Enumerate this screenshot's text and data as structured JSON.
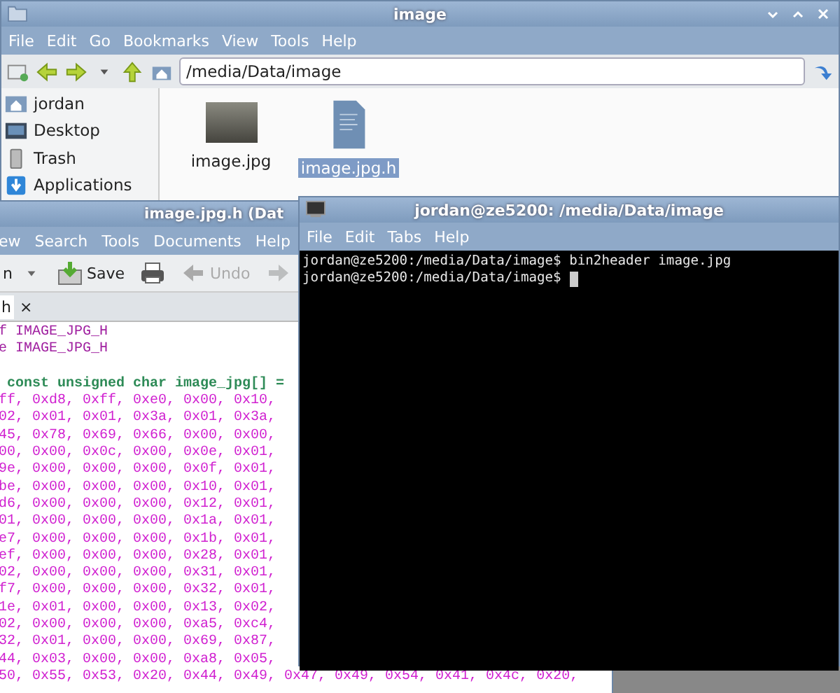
{
  "file_manager": {
    "title": "image",
    "menu": [
      "File",
      "Edit",
      "Go",
      "Bookmarks",
      "View",
      "Tools",
      "Help"
    ],
    "location": "/media/Data/image",
    "sidebar": [
      {
        "label": "jordan",
        "kind": "home"
      },
      {
        "label": "Desktop",
        "kind": "desktop"
      },
      {
        "label": "Trash",
        "kind": "trash"
      },
      {
        "label": "Applications",
        "kind": "apps"
      }
    ],
    "files": [
      {
        "name": "image.jpg",
        "kind": "photo",
        "selected": false
      },
      {
        "name": "image.jpg.h",
        "kind": "text",
        "selected": true
      }
    ]
  },
  "editor": {
    "title": "image.jpg.h (Dat",
    "menu": [
      "ew",
      "Search",
      "Tools",
      "Documents",
      "Help"
    ],
    "toolbar": [
      {
        "label": "n",
        "kind": "dropdown"
      },
      {
        "label": "Save",
        "kind": "save"
      },
      {
        "kind": "print"
      },
      {
        "label": "Undo",
        "kind": "undo",
        "disabled": true
      },
      {
        "kind": "redo",
        "disabled": true
      }
    ],
    "tab": "h",
    "tab_close": "×",
    "lines": [
      {
        "text": "f IMAGE_JPG_H",
        "kind": "directive"
      },
      {
        "text": "e IMAGE_JPG_H",
        "kind": "directive"
      },
      {
        "kind": "blank"
      },
      {
        "text": " const unsigned char image_jpg[] =",
        "kind": "declaration"
      },
      {
        "text": "ff, 0xd8, 0xff, 0xe0, 0x00, 0x10,",
        "kind": "hex"
      },
      {
        "text": "02, 0x01, 0x01, 0x3a, 0x01, 0x3a,",
        "kind": "hex"
      },
      {
        "text": "45, 0x78, 0x69, 0x66, 0x00, 0x00,",
        "kind": "hex"
      },
      {
        "text": "00, 0x00, 0x0c, 0x00, 0x0e, 0x01,",
        "kind": "hex"
      },
      {
        "text": "9e, 0x00, 0x00, 0x00, 0x0f, 0x01,",
        "kind": "hex"
      },
      {
        "text": "be, 0x00, 0x00, 0x00, 0x10, 0x01,",
        "kind": "hex"
      },
      {
        "text": "d6, 0x00, 0x00, 0x00, 0x12, 0x01,",
        "kind": "hex"
      },
      {
        "text": "01, 0x00, 0x00, 0x00, 0x1a, 0x01,",
        "kind": "hex"
      },
      {
        "text": "e7, 0x00, 0x00, 0x00, 0x1b, 0x01,",
        "kind": "hex"
      },
      {
        "text": "ef, 0x00, 0x00, 0x00, 0x28, 0x01,",
        "kind": "hex"
      },
      {
        "text": "02, 0x00, 0x00, 0x00, 0x31, 0x01,",
        "kind": "hex"
      },
      {
        "text": "f7, 0x00, 0x00, 0x00, 0x32, 0x01,",
        "kind": "hex"
      },
      {
        "text": "1e, 0x01, 0x00, 0x00, 0x13, 0x02,",
        "kind": "hex"
      },
      {
        "text": "02, 0x00, 0x00, 0x00, 0xa5, 0xc4,",
        "kind": "hex"
      },
      {
        "text": "32, 0x01, 0x00, 0x00, 0x69, 0x87,",
        "kind": "hex"
      },
      {
        "text": "44, 0x03, 0x00, 0x00, 0xa8, 0x05,",
        "kind": "hex"
      },
      {
        "text": "50, 0x55, 0x53, 0x20, 0x44, 0x49, 0x47, 0x49, 0x54, 0x41, 0x4c, 0x20,",
        "kind": "hex"
      }
    ]
  },
  "terminal": {
    "title": "jordan@ze5200: /media/Data/image",
    "menu": [
      "File",
      "Edit",
      "Tabs",
      "Help"
    ],
    "lines": [
      "jordan@ze5200:/media/Data/image$ bin2header image.jpg",
      "jordan@ze5200:/media/Data/image$ "
    ]
  }
}
